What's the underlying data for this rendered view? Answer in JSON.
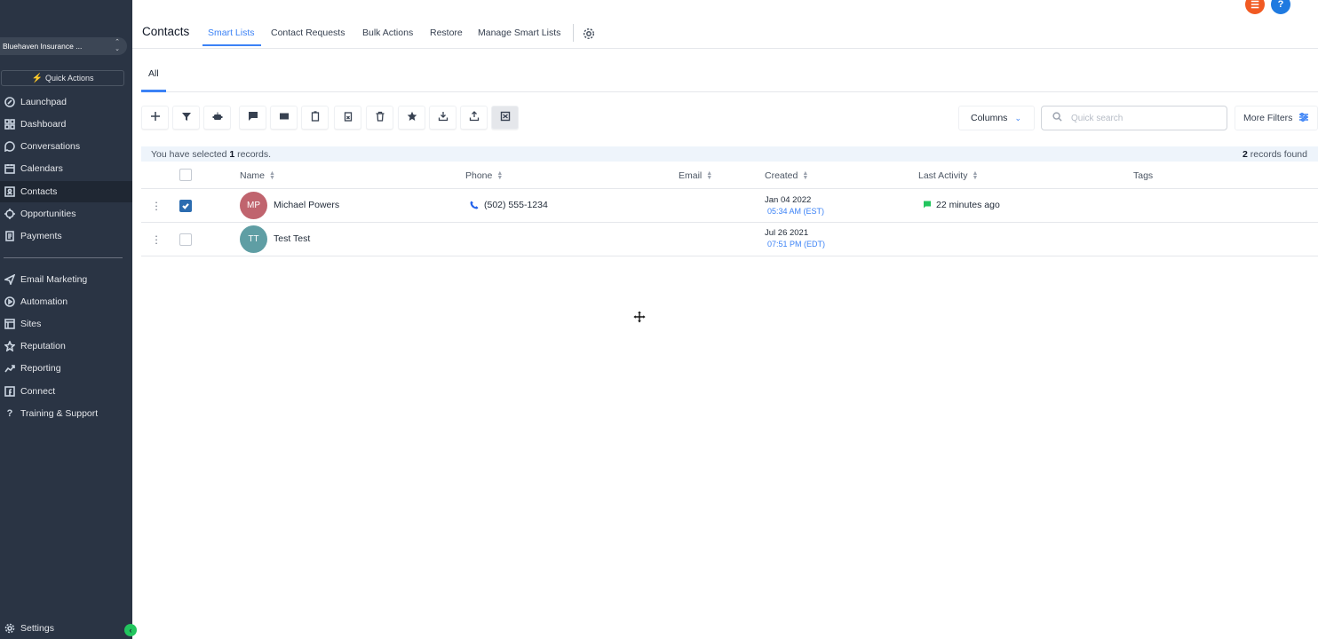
{
  "sidebar": {
    "account_name": "Bluehaven Insurance ...",
    "quick_actions": "Quick Actions",
    "items": [
      {
        "label": "Launchpad",
        "icon": "rocket-icon"
      },
      {
        "label": "Dashboard",
        "icon": "grid-icon"
      },
      {
        "label": "Conversations",
        "icon": "chat-bubble-icon"
      },
      {
        "label": "Calendars",
        "icon": "calendar-icon"
      },
      {
        "label": "Contacts",
        "icon": "contact-card-icon",
        "active": true
      },
      {
        "label": "Opportunities",
        "icon": "funnel-icon"
      },
      {
        "label": "Payments",
        "icon": "receipt-icon"
      },
      {
        "label": "Email Marketing",
        "icon": "paper-plane-icon"
      },
      {
        "label": "Automation",
        "icon": "automation-icon"
      },
      {
        "label": "Sites",
        "icon": "globe-icon"
      },
      {
        "label": "Reputation",
        "icon": "star-icon"
      },
      {
        "label": "Reporting",
        "icon": "trend-chart-icon"
      },
      {
        "label": "Connect",
        "icon": "facebook-icon"
      },
      {
        "label": "Training & Support",
        "icon": "question-icon"
      }
    ],
    "settings": "Settings"
  },
  "header": {
    "title": "Contacts",
    "tabs": [
      "Smart Lists",
      "Contact Requests",
      "Bulk Actions",
      "Restore",
      "Manage Smart Lists"
    ],
    "active_tab": "Smart Lists"
  },
  "subtabs": {
    "all": "All"
  },
  "toolbar": {
    "icons": [
      "add-icon",
      "filter-icon",
      "robot-icon",
      "sms-icon",
      "email-icon",
      "copy-icon",
      "paste-icon",
      "delete-icon",
      "star-icon",
      "import-icon",
      "export-icon",
      "merge-icon"
    ],
    "columns_label": "Columns",
    "search_placeholder": "Quick search",
    "more_filters_label": "More Filters"
  },
  "selection": {
    "prefix": "You have selected",
    "count": "1",
    "suffix": "records.",
    "found_count": "2",
    "found_suffix": "records found"
  },
  "table": {
    "headers": [
      "Name",
      "Phone",
      "Email",
      "Created",
      "Last Activity",
      "Tags"
    ],
    "rows": [
      {
        "checked": true,
        "initials": "MP",
        "avatar_color": "#c0646e",
        "name": "Michael Powers",
        "phone": "(502) 555-1234",
        "email": "",
        "created_date": "Jan 04 2022",
        "created_time": "05:34 AM (EST)",
        "last_activity": "22 minutes ago",
        "tags": ""
      },
      {
        "checked": false,
        "initials": "TT",
        "avatar_color": "#5f9ea4",
        "name": "Test Test",
        "phone": "",
        "email": "",
        "created_date": "Jul 26 2021",
        "created_time": "07:51 PM (EDT)",
        "last_activity": "",
        "tags": ""
      }
    ]
  },
  "colors": {
    "accent": "#3b82f6",
    "sidebar_bg": "#2a3444",
    "orange_btn": "#f15a22",
    "help_btn": "#1f7ae0"
  }
}
